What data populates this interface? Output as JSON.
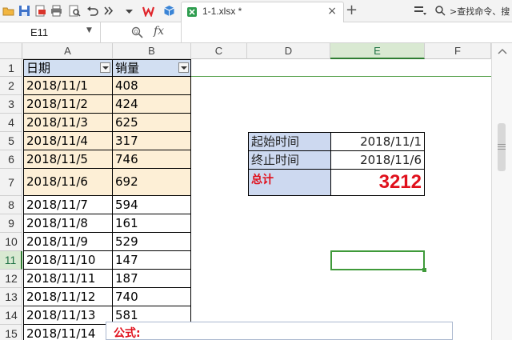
{
  "toolbar": {
    "icons": [
      "folder-icon",
      "save-icon",
      "export-pdf-icon",
      "print-icon",
      "print-preview-icon",
      "undo-icon",
      "more-icon",
      "dropdown-icon",
      "wps-logo-icon",
      "apps-cube-icon"
    ],
    "doc_tab": {
      "title": "1-1.xlsx *",
      "close": "×"
    },
    "new_tab": "+",
    "search_label": ">查找命令、搜"
  },
  "formula_bar": {
    "name_box": "E11",
    "fx_label": "fx",
    "formula": ""
  },
  "columns": [
    "A",
    "B",
    "C",
    "D",
    "E",
    "F"
  ],
  "selected_column": "E",
  "rows": [
    "1",
    "2",
    "3",
    "4",
    "5",
    "6",
    "7",
    "8",
    "9",
    "10",
    "11",
    "12",
    "13",
    "14",
    "15"
  ],
  "selected_row": "11",
  "table": {
    "headers": [
      "日期",
      "销量"
    ],
    "rows": [
      [
        "2018/11/1",
        "408"
      ],
      [
        "2018/11/2",
        "424"
      ],
      [
        "2018/11/3",
        "625"
      ],
      [
        "2018/11/4",
        "317"
      ],
      [
        "2018/11/5",
        "746"
      ],
      [
        "2018/11/6",
        "692"
      ],
      [
        "2018/11/7",
        "594"
      ],
      [
        "2018/11/8",
        "161"
      ],
      [
        "2018/11/9",
        "529"
      ],
      [
        "2018/11/10",
        "147"
      ],
      [
        "2018/11/11",
        "187"
      ],
      [
        "2018/11/12",
        "740"
      ],
      [
        "2018/11/13",
        "581"
      ],
      [
        "2018/11/14",
        ""
      ]
    ],
    "shaded_row_count": 6
  },
  "summary": {
    "start_label": "起始时间",
    "start_value": "2018/11/1",
    "end_label": "终止时间",
    "end_value": "2018/11/6",
    "total_label": "总计",
    "total_value": "3212"
  },
  "formula_popup": {
    "title": "公式:"
  },
  "colors": {
    "highlight_fill": "#fdefd6",
    "header_fill": "#d2dff2",
    "label_fill": "#cdd9f0",
    "total_red": "#e0101c",
    "selection_green": "#3f9a3a"
  }
}
